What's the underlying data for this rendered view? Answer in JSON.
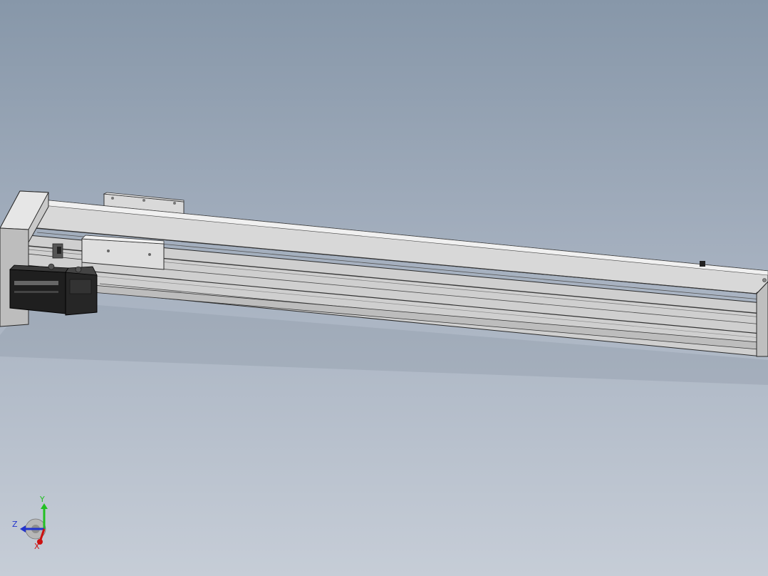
{
  "viewport": {
    "background_top": "#8797a9",
    "background_bottom": "#c6cdd7"
  },
  "model": {
    "description_name": "linear-actuator-module",
    "parts": [
      "rail-profile",
      "slide-carriage",
      "stepper-motor",
      "end-plate",
      "end-cap",
      "top-bracket"
    ]
  },
  "triad": {
    "y_label": "Y",
    "z_label": "Z",
    "x_label": "X",
    "y_color": "#22c022",
    "z_color": "#2233cc",
    "x_color": "#cc1111"
  }
}
